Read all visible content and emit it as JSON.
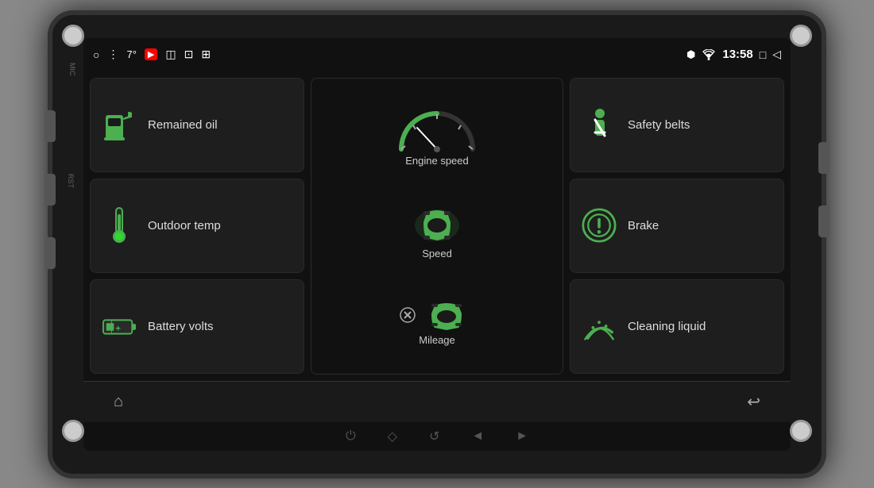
{
  "device": {
    "mic_label": "MIC",
    "rst_label": "RST"
  },
  "status_bar": {
    "temp": "7°",
    "time": "13:58",
    "icons": {
      "circle": "○",
      "menu": "⋮",
      "youtube": "▶",
      "cam1": "◫",
      "cam2": "⊡",
      "cam3": "⊞",
      "bluetooth": "⬡",
      "wifi": "▲",
      "square": "□",
      "back": "◁"
    }
  },
  "tiles": {
    "remained_oil": {
      "label": "Remained oil",
      "icon": "fuel-icon"
    },
    "outdoor_temp": {
      "label": "Outdoor temp",
      "icon": "thermometer-icon"
    },
    "battery_volts": {
      "label": "Battery volts",
      "icon": "battery-icon"
    },
    "engine_speed": {
      "label": "Engine speed",
      "icon": "speedometer-icon"
    },
    "speed": {
      "label": "Speed",
      "icon": "speed-icon"
    },
    "mileage": {
      "label": "Mileage",
      "icon": "mileage-icon"
    },
    "safety_belts": {
      "label": "Safety belts",
      "icon": "seatbelt-icon"
    },
    "brake": {
      "label": "Brake",
      "icon": "brake-icon"
    },
    "cleaning_liquid": {
      "label": "Cleaning liquid",
      "icon": "wiper-icon"
    }
  },
  "bottom_bar": {
    "home": "⌂",
    "back": "↩"
  },
  "physical_buttons": {
    "power": "⏻",
    "home": "◇",
    "back": "↺",
    "vol_down": "◄",
    "vol_up": "►"
  }
}
